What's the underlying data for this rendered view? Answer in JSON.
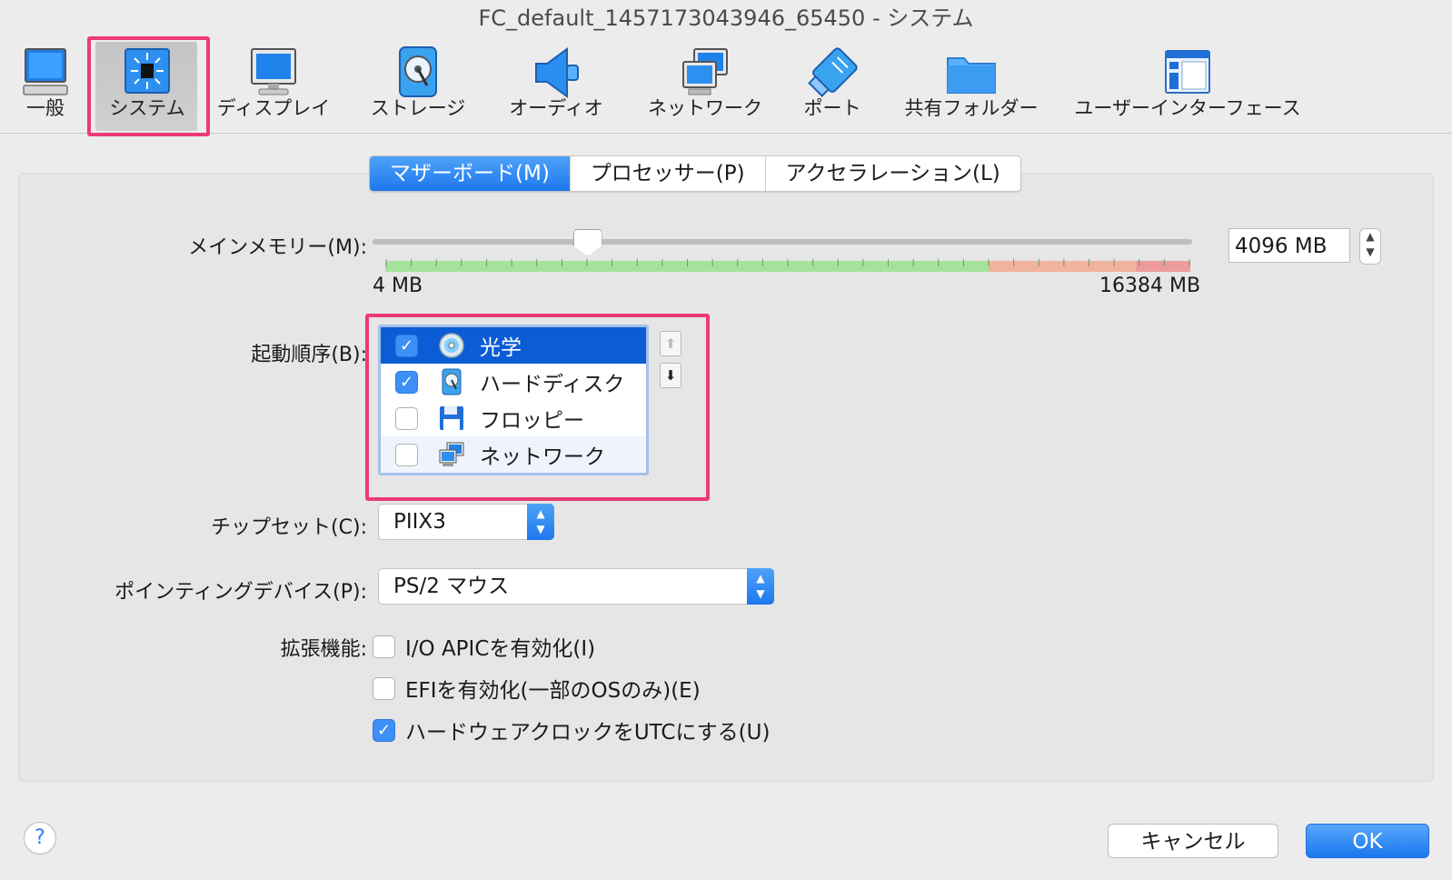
{
  "window": {
    "title": "FC_default_1457173043946_65450 - システム"
  },
  "toolbar": {
    "items": [
      {
        "label": "一般",
        "icon": "general-monitor-icon"
      },
      {
        "label": "システム",
        "icon": "system-chip-icon",
        "selected": true
      },
      {
        "label": "ディスプレイ",
        "icon": "display-monitor-icon"
      },
      {
        "label": "ストレージ",
        "icon": "storage-disk-icon"
      },
      {
        "label": "オーディオ",
        "icon": "audio-speaker-icon"
      },
      {
        "label": "ネットワーク",
        "icon": "network-icon"
      },
      {
        "label": "ポート",
        "icon": "port-connector-icon"
      },
      {
        "label": "共有フォルダー",
        "icon": "shared-folder-icon"
      },
      {
        "label": "ユーザーインターフェース",
        "icon": "user-interface-icon"
      }
    ]
  },
  "tabs": [
    {
      "label": "マザーボード(M)",
      "active": true
    },
    {
      "label": "プロセッサー(P)"
    },
    {
      "label": "アクセラレーション(L)"
    }
  ],
  "memory": {
    "label": "メインメモリー(M):",
    "value": "4096 MB",
    "min_label": "4 MB",
    "max_label": "16384 MB",
    "fraction": 0.25,
    "green": "#a6e29b",
    "orange": "#f0b49c",
    "red": "#ee9b9b"
  },
  "boot_order": {
    "label": "起動順序(B):",
    "items": [
      {
        "label": "光学",
        "checked": true,
        "icon": "optical-disc-icon"
      },
      {
        "label": "ハードディスク",
        "checked": true,
        "icon": "hard-disk-icon"
      },
      {
        "label": "フロッピー",
        "checked": false,
        "icon": "floppy-disk-icon"
      },
      {
        "label": "ネットワーク",
        "checked": false,
        "icon": "network-icon"
      }
    ],
    "selected_index": 0
  },
  "chipset": {
    "label": "チップセット(C):",
    "value": "PIIX3"
  },
  "pointing": {
    "label": "ポインティングデバイス(P):",
    "value": "PS/2 マウス"
  },
  "extended": {
    "label": "拡張機能:",
    "options": [
      {
        "label": "I/O APICを有効化(I)",
        "checked": false
      },
      {
        "label": "EFIを有効化(一部のOSのみ)(E)",
        "checked": false
      },
      {
        "label": "ハードウェアクロックをUTCにする(U)",
        "checked": true
      }
    ]
  },
  "buttons": {
    "help": "?",
    "cancel": "キャンセル",
    "ok": "OK"
  },
  "colors": {
    "accent": "#1d78ee",
    "highlight": "#ec3b72"
  }
}
